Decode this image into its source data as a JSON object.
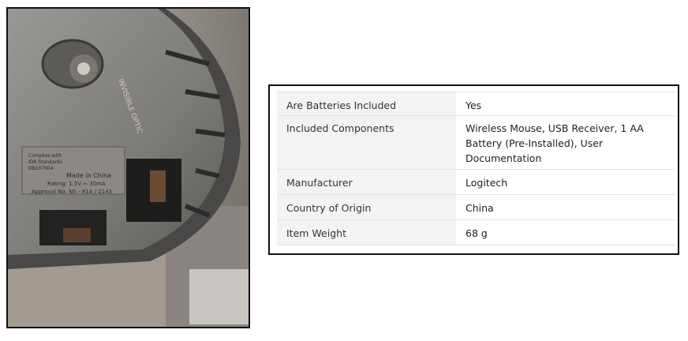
{
  "photo": {
    "icon": "mouse-underside-photo",
    "label_text": [
      "Complies with",
      "IDA Standards",
      "DB107004",
      "Made in China",
      "Rating: 1.5V ⎓ 30mA",
      "Approval No. NS - 81A / 2143"
    ],
    "engraved_text": "INVISIBLE OPTIC"
  },
  "specs": {
    "rows": [
      {
        "label": "Are Batteries Included",
        "value": "Yes"
      },
      {
        "label": "Included Components",
        "value": "Wireless Mouse, USB Receiver, 1 AA Battery (Pre-Installed), User Documentation"
      },
      {
        "label": "Manufacturer",
        "value": "Logitech"
      },
      {
        "label": "Country of Origin",
        "value": "China"
      },
      {
        "label": "Item Weight",
        "value": "68 g"
      }
    ]
  }
}
